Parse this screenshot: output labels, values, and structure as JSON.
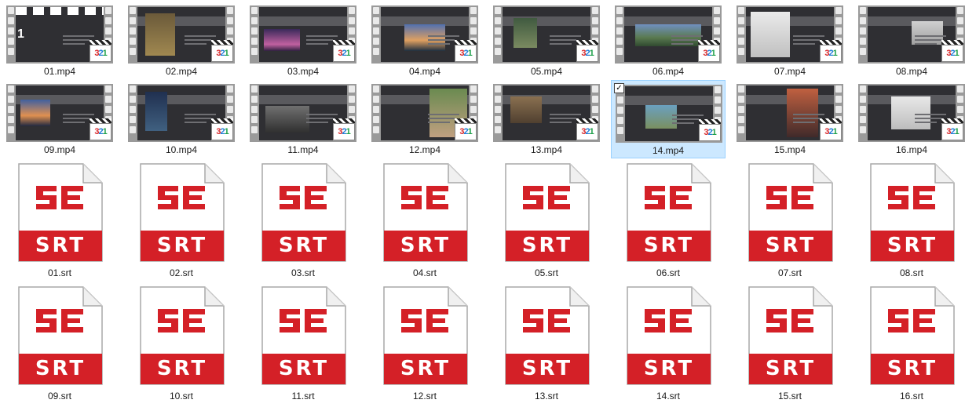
{
  "colors": {
    "selection_bg": "#cce8ff",
    "selection_border": "#99d1ff",
    "srt_red": "#d42027",
    "film_gray": "#9a9a9a",
    "slide_dark": "#2f2f33"
  },
  "icons": {
    "video": "film-strip-thumbnail-icon",
    "player_badge": "321-player-badge-icon",
    "srt": "srt-file-icon"
  },
  "badge_text": {
    "d1": "3",
    "d2": "2",
    "d3": "1"
  },
  "srt_badge_text": "SRT",
  "srt_logo_text": "SE",
  "check_glyph": "✓",
  "files": [
    {
      "name": "01.mp4",
      "type": "video",
      "slide_number": "1"
    },
    {
      "name": "02.mp4",
      "type": "video"
    },
    {
      "name": "03.mp4",
      "type": "video"
    },
    {
      "name": "04.mp4",
      "type": "video"
    },
    {
      "name": "05.mp4",
      "type": "video"
    },
    {
      "name": "06.mp4",
      "type": "video"
    },
    {
      "name": "07.mp4",
      "type": "video"
    },
    {
      "name": "08.mp4",
      "type": "video"
    },
    {
      "name": "09.mp4",
      "type": "video"
    },
    {
      "name": "10.mp4",
      "type": "video"
    },
    {
      "name": "11.mp4",
      "type": "video"
    },
    {
      "name": "12.mp4",
      "type": "video"
    },
    {
      "name": "13.mp4",
      "type": "video"
    },
    {
      "name": "14.mp4",
      "type": "video",
      "selected": true
    },
    {
      "name": "15.mp4",
      "type": "video"
    },
    {
      "name": "16.mp4",
      "type": "video"
    },
    {
      "name": "01.srt",
      "type": "srt"
    },
    {
      "name": "02.srt",
      "type": "srt"
    },
    {
      "name": "03.srt",
      "type": "srt"
    },
    {
      "name": "04.srt",
      "type": "srt"
    },
    {
      "name": "05.srt",
      "type": "srt"
    },
    {
      "name": "06.srt",
      "type": "srt"
    },
    {
      "name": "07.srt",
      "type": "srt"
    },
    {
      "name": "08.srt",
      "type": "srt"
    },
    {
      "name": "09.srt",
      "type": "srt"
    },
    {
      "name": "10.srt",
      "type": "srt"
    },
    {
      "name": "11.srt",
      "type": "srt"
    },
    {
      "name": "12.srt",
      "type": "srt"
    },
    {
      "name": "13.srt",
      "type": "srt"
    },
    {
      "name": "14.srt",
      "type": "srt"
    },
    {
      "name": "15.srt",
      "type": "srt"
    },
    {
      "name": "16.srt",
      "type": "srt"
    }
  ]
}
